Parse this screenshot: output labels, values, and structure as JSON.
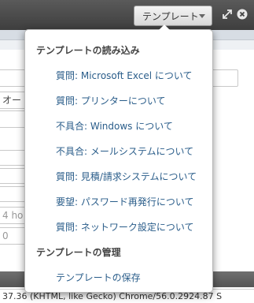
{
  "toolbar": {
    "template_button_label": "テンプレート",
    "expand_icon": "expand-icon",
    "close_icon": "close-icon"
  },
  "background": {
    "field_values": [
      "オー",
      "4 ho",
      "0"
    ],
    "user_agent_text": "37.36 (KHTML, like Gecko) Chrome/56.0.2924.87 S"
  },
  "menu": {
    "load_heading": "テンプレートの読み込み",
    "load_items": [
      "質問: Microsoft Excel について",
      "質問: プリンターについて",
      "不具合: Windows について",
      "不具合: メールシステムについて",
      "質問: 見積/請求システムについて",
      "要望: パスワード再発行について",
      "質問: ネットワーク設定について"
    ],
    "manage_heading": "テンプレートの管理",
    "manage_items": [
      "テンプレートの保存"
    ]
  },
  "colors": {
    "link": "#2a5d8a",
    "heading": "#444444",
    "topbar": "#4a4a4a"
  }
}
